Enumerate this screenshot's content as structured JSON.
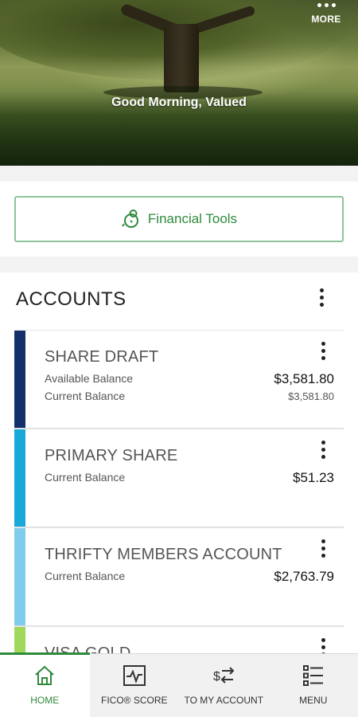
{
  "header": {
    "more_label": "MORE",
    "greeting": "Good Morning, Valued"
  },
  "tools": {
    "label": "Financial Tools",
    "icon": "piggy-bank-icon"
  },
  "accounts": {
    "title": "ACCOUNTS",
    "items": [
      {
        "name": "SHARE DRAFT",
        "color": "#14306a",
        "label1": "Available Balance",
        "value1": "$3,581.80",
        "label2": "Current Balance",
        "value2": "$3,581.80"
      },
      {
        "name": "PRIMARY SHARE",
        "color": "#19a9d8",
        "label1": "Current Balance",
        "value1": "$51.23"
      },
      {
        "name": "THRIFTY MEMBERS ACCOUNT",
        "color": "#7fcdec",
        "label1": "Current Balance",
        "value1": "$2,763.79"
      },
      {
        "name": "VISA GOLD",
        "color": "#9fd85a"
      }
    ]
  },
  "nav": {
    "items": [
      {
        "label": "HOME",
        "icon": "home-icon",
        "active": true
      },
      {
        "label": "FICO® SCORE",
        "icon": "chart-icon",
        "active": false
      },
      {
        "label": "TO MY ACCOUNT",
        "icon": "transfer-icon",
        "active": false
      },
      {
        "label": "MENU",
        "icon": "menu-list-icon",
        "active": false
      }
    ]
  },
  "colors": {
    "brand_green": "#2e8a3c",
    "tools_border": "#8fc39a"
  }
}
